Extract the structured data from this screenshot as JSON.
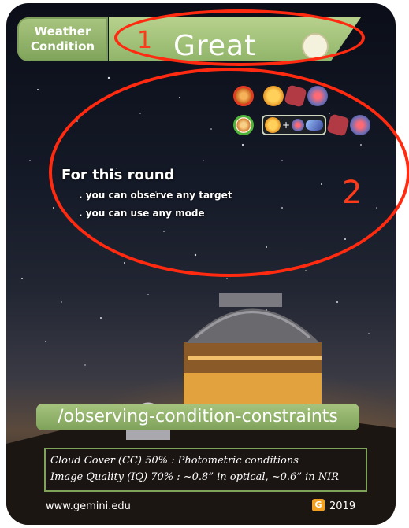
{
  "header": {
    "label_line1": "Weather",
    "label_line2": "Condition",
    "value": "Great",
    "value_icon": "moon-icon"
  },
  "annotations": {
    "marker_1": "1",
    "marker_2": "2",
    "color": "#ff2a10"
  },
  "mode_icons": {
    "row1": [
      "red-ring-target-icon",
      "sun-icon",
      "hex-object-icon",
      "galaxy-icon"
    ],
    "row2": [
      "green-ring-target-icon",
      "sun-plus-planet-icon",
      "comet-icon",
      "hex-object-icon",
      "galaxy-icon"
    ],
    "plus_text": "+"
  },
  "round": {
    "title": "For this round",
    "bullets": [
      ". you can observe any target",
      ". you can use any mode"
    ]
  },
  "url_bar": "/observing-condition-constraints",
  "info": {
    "line1": "Cloud Cover (CC) 50% :  Photometric conditions",
    "line2": "Image Quality (IQ) 70% : ~0.8” in optical, ~0.6” in NIR"
  },
  "footer": {
    "site": "www.gemini.edu",
    "logo_letter": "G",
    "year": "2019"
  },
  "colors": {
    "green_accent": "#8fb366",
    "sky_dark": "#0b0e18"
  }
}
